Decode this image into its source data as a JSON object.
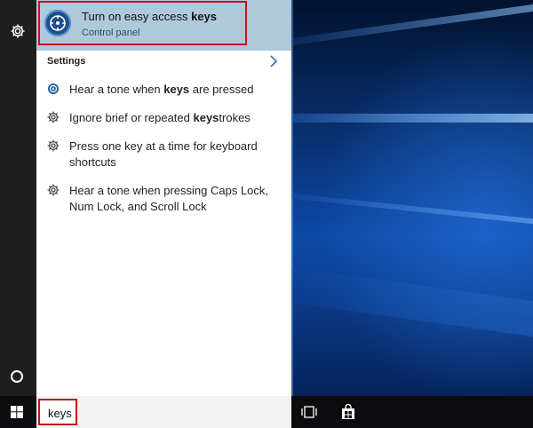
{
  "best_match": {
    "title_prefix": "Turn on easy access ",
    "title_bold": "keys",
    "subtitle": "Control panel",
    "icon": "ease-of-access-icon"
  },
  "settings": {
    "header": "Settings",
    "items": [
      {
        "prefix": "Hear a tone when ",
        "bold": "keys",
        "suffix": " are pressed",
        "icon": "ease-of-access-small-icon"
      },
      {
        "prefix": "Ignore brief or repeated ",
        "bold": "keys",
        "suffix": "trokes",
        "icon": "gear-icon"
      },
      {
        "prefix": "Press one key at a time for keyboard shortcuts",
        "bold": "",
        "suffix": "",
        "icon": "gear-icon"
      },
      {
        "prefix": "Hear a tone when pressing Caps Lock, Num Lock, and Scroll Lock",
        "bold": "",
        "suffix": "",
        "icon": "gear-icon"
      }
    ]
  },
  "search": {
    "value": "keys"
  },
  "rail": {
    "icons": [
      "gear-icon",
      "cortana-circle-icon"
    ]
  },
  "taskbar": {
    "icons": [
      "windows-start-icon",
      "task-view-icon",
      "store-icon"
    ]
  },
  "colors": {
    "selection": "#aec8dc",
    "highlight_frame": "#c0141a",
    "taskbar": "#0c0c0f",
    "rail": "#1f1f1f"
  }
}
